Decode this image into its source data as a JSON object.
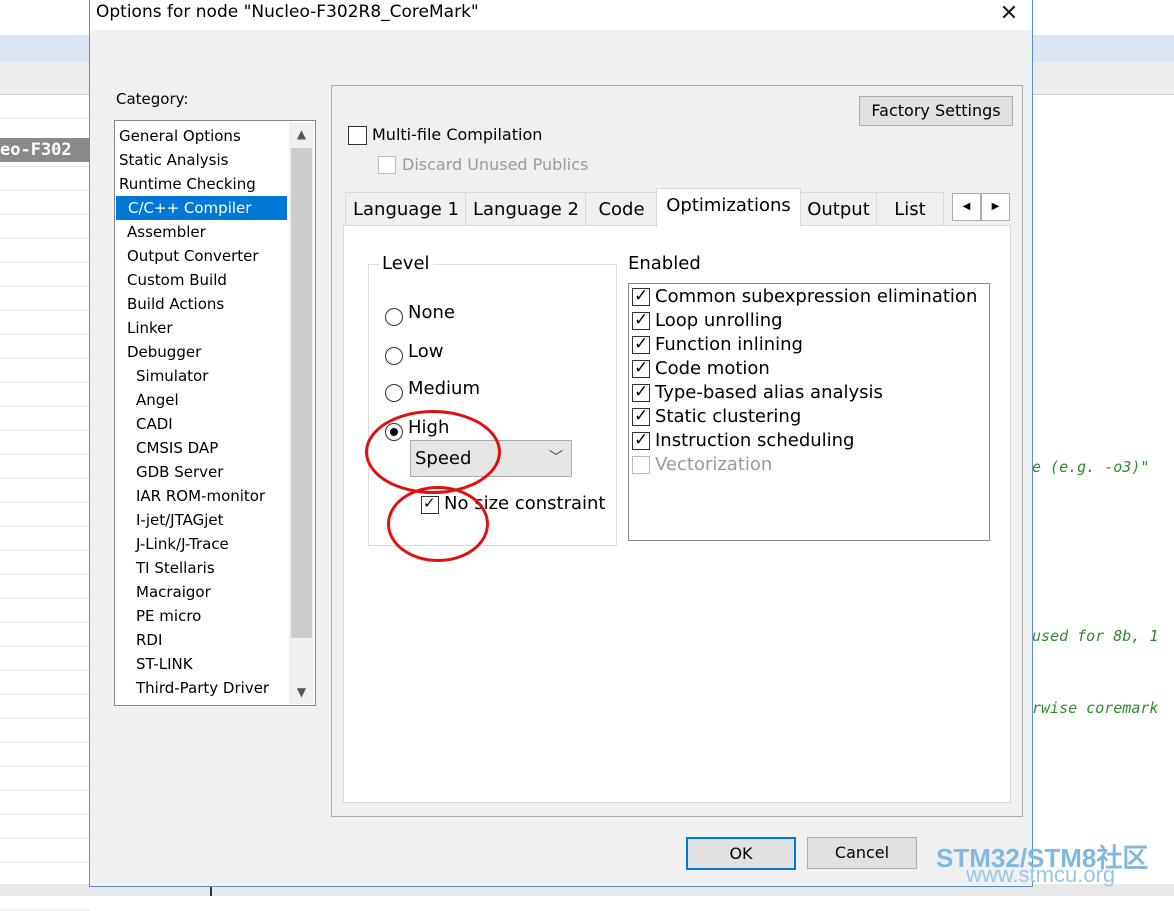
{
  "dialog": {
    "title": "Options for node \"Nucleo-F302R8_CoreMark\"",
    "close_glyph": "✕",
    "category_label": "Category:",
    "categories": [
      {
        "label": "General Options"
      },
      {
        "label": "Static Analysis"
      },
      {
        "label": "Runtime Checking"
      },
      {
        "label": "C/C++ Compiler",
        "selected": true
      },
      {
        "label": "Assembler"
      },
      {
        "label": "Output Converter"
      },
      {
        "label": "Custom Build"
      },
      {
        "label": "Build Actions"
      },
      {
        "label": "Linker"
      },
      {
        "label": "Debugger"
      },
      {
        "label": "Simulator"
      },
      {
        "label": "Angel"
      },
      {
        "label": "CADI"
      },
      {
        "label": "CMSIS DAP"
      },
      {
        "label": "GDB Server"
      },
      {
        "label": "IAR ROM-monitor"
      },
      {
        "label": "I-jet/JTAGjet"
      },
      {
        "label": "J-Link/J-Trace"
      },
      {
        "label": "TI Stellaris"
      },
      {
        "label": "Macraigor"
      },
      {
        "label": "PE micro"
      },
      {
        "label": "RDI"
      },
      {
        "label": "ST-LINK"
      },
      {
        "label": "Third-Party Driver"
      }
    ],
    "factory_settings": "Factory Settings",
    "multi_file": {
      "label": "Multi-file Compilation",
      "checked": false
    },
    "discard_unused": {
      "label": "Discard Unused Publics",
      "checked": false,
      "disabled": true
    },
    "tabs": [
      "Language 1",
      "Language 2",
      "Code",
      "Optimizations",
      "Output",
      "List"
    ],
    "active_tab": "Optimizations",
    "level": {
      "legend": "Level",
      "options": [
        "None",
        "Low",
        "Medium",
        "High"
      ],
      "selected": "High",
      "goal_value": "Speed",
      "no_size_label": "No size constraints",
      "no_size_checked": true
    },
    "enabled": {
      "legend": "Enabled",
      "items": [
        {
          "label": "Common subexpression elimination",
          "checked": true
        },
        {
          "label": "Loop unrolling",
          "checked": true
        },
        {
          "label": "Function inlining",
          "checked": true
        },
        {
          "label": "Code motion",
          "checked": true
        },
        {
          "label": "Type-based alias analysis",
          "checked": true
        },
        {
          "label": "Static clustering",
          "checked": true
        },
        {
          "label": "Instruction scheduling",
          "checked": true
        },
        {
          "label": "Vectorization",
          "checked": false,
          "disabled": true
        }
      ]
    },
    "ok_label": "OK",
    "cancel_label": "Cancel"
  },
  "background": {
    "node_label": "eo-F302",
    "code_lines": [
      "e (e.g. -o3)\"",
      "used for 8b, 1",
      "rwise coremark"
    ]
  },
  "watermark": {
    "main_a": "STM32",
    "main_b": "/STM8社区",
    "url": "www.stmcu.org"
  },
  "colors": {
    "accent": "#0078d7",
    "annotation": "#e01010",
    "code": "#2e8b2e"
  }
}
